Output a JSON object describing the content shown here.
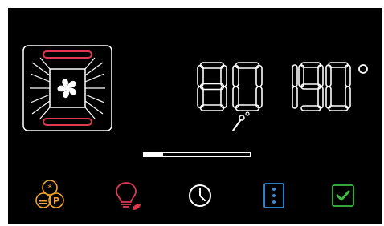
{
  "display": {
    "food_temperature": "80",
    "oven_temperature": "190",
    "degree_symbol": "°",
    "probe_unit": "°"
  },
  "progress": {
    "fraction": 0.18
  },
  "icons": {
    "oven": "oven-fan-icon",
    "functions": "cooking-functions-icon",
    "light": "eco-light-icon",
    "timer": "clock-icon",
    "menu": "options-menu-icon",
    "confirm": "checkbox-check-icon"
  },
  "function_badges": [
    "*",
    "P"
  ],
  "colors": {
    "background": "#000000",
    "digits": "#ffffff",
    "heater": "#e0394f",
    "functions": "#f2a531",
    "light": "#e0394f",
    "menu": "#2f8fe0",
    "confirm": "#3dbb45"
  }
}
